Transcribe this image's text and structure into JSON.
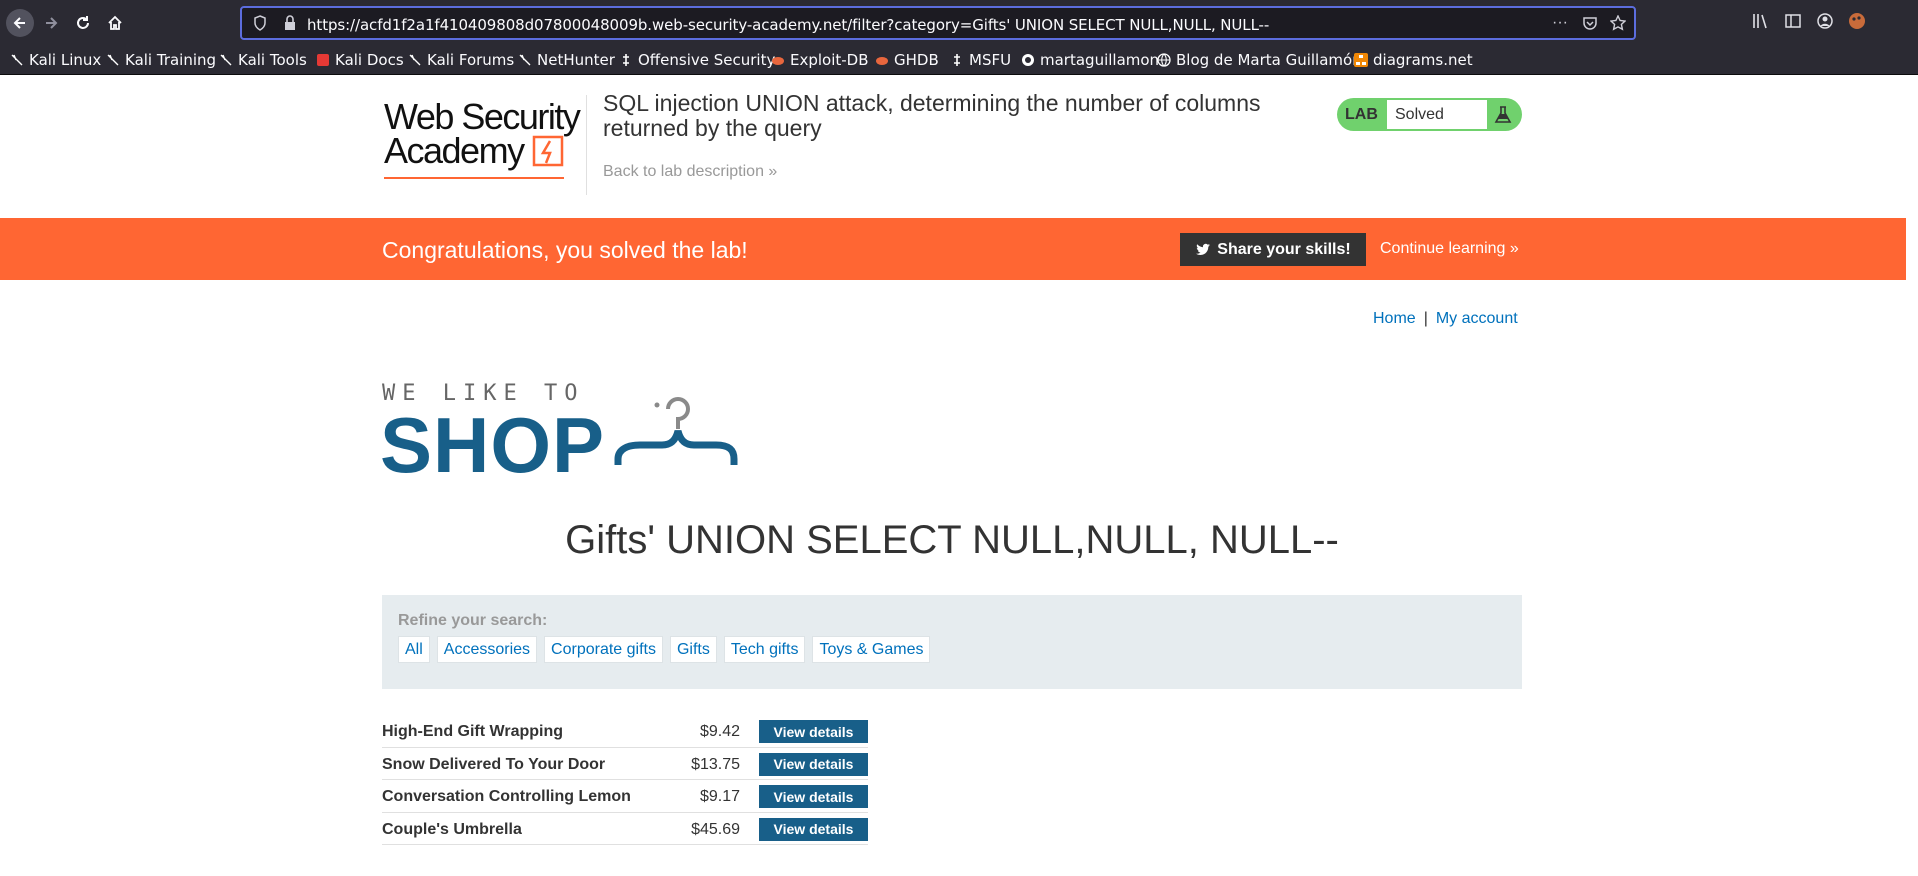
{
  "browser": {
    "url": "https://acfd1f2a1f410409808d07800048009b.web-security-academy.net/filter?category=Gifts' UNION SELECT NULL,NULL, NULL--",
    "bookmarks": [
      {
        "label": "Kali Linux",
        "icon": "kali-dragon-icon",
        "color": "#ffffff"
      },
      {
        "label": "Kali Training",
        "icon": "kali-dragon-icon",
        "color": "#ffffff"
      },
      {
        "label": "Kali Tools",
        "icon": "kali-dragon-icon",
        "color": "#ffffff"
      },
      {
        "label": "Kali Docs",
        "icon": "kali-docs-icon",
        "color": "#e53935"
      },
      {
        "label": "Kali Forums",
        "icon": "kali-dragon-icon",
        "color": "#ffffff"
      },
      {
        "label": "NetHunter",
        "icon": "kali-dragon-icon",
        "color": "#ffffff"
      },
      {
        "label": "Offensive Security",
        "icon": "offsec-icon",
        "color": "#ffffff"
      },
      {
        "label": "Exploit-DB",
        "icon": "exploit-db-icon",
        "color": "#e8663d"
      },
      {
        "label": "GHDB",
        "icon": "ghdb-icon",
        "color": "#e8663d"
      },
      {
        "label": "MSFU",
        "icon": "msfu-icon",
        "color": "#ffffff"
      },
      {
        "label": "martaguillamon",
        "icon": "github-icon",
        "color": "#ffffff"
      },
      {
        "label": "Blog de Marta Guillamón",
        "icon": "globe-icon",
        "color": "#ffffff"
      },
      {
        "label": "diagrams.net",
        "icon": "diagrams-icon",
        "color": "#f08705"
      }
    ]
  },
  "lab": {
    "logo_line1": "Web Security",
    "logo_line2": "Academy",
    "title": "SQL injection UNION attack, determining the number of columns returned by the query",
    "back_link": "Back to lab description »",
    "status_label": "LAB",
    "status_value": "Solved",
    "banner_text": "Congratulations, you solved the lab!",
    "share_label": "Share your skills!",
    "continue_label": "Continue learning »",
    "accent_color": "#ff6633",
    "solved_color": "#70d16d"
  },
  "nav": {
    "home": "Home",
    "separator": "|",
    "account": "My account"
  },
  "shop": {
    "tagline": "WE LIKE TO",
    "name": "SHOP",
    "brand_color": "#185f89"
  },
  "category_title": "Gifts' UNION SELECT NULL,NULL, NULL--",
  "filter": {
    "label": "Refine your search:",
    "items": [
      "All",
      "Accessories",
      "Corporate gifts",
      "Gifts",
      "Tech gifts",
      "Toys & Games"
    ]
  },
  "products": [
    {
      "name": "High-End Gift Wrapping",
      "price": "$9.42",
      "action": "View details"
    },
    {
      "name": "Snow Delivered To Your Door",
      "price": "$13.75",
      "action": "View details"
    },
    {
      "name": "Conversation Controlling Lemon",
      "price": "$9.17",
      "action": "View details"
    },
    {
      "name": "Couple's Umbrella",
      "price": "$45.69",
      "action": "View details"
    }
  ]
}
